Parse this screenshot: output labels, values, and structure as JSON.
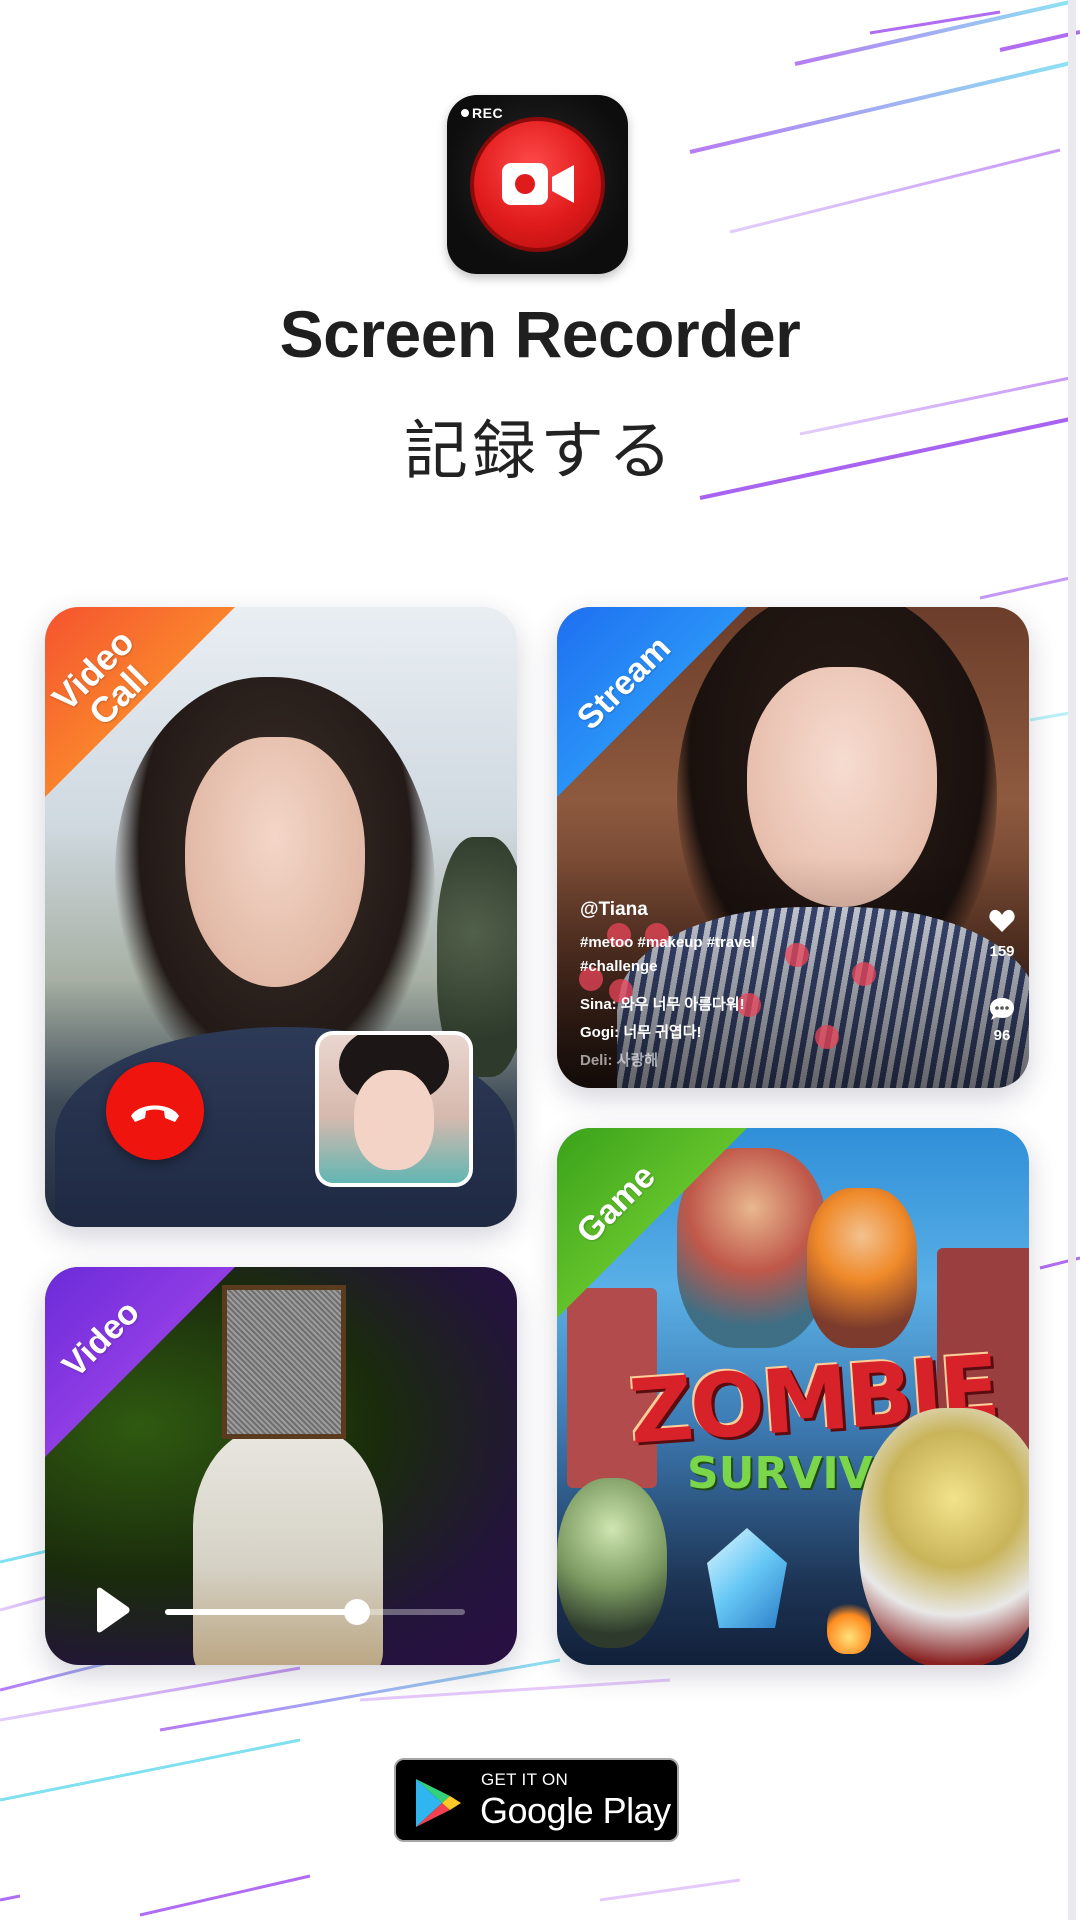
{
  "header": {
    "rec_label": "REC",
    "title": "Screen Recorder",
    "subtitle": "記録する"
  },
  "cards": {
    "video_call": {
      "label_line1": "Video",
      "label_line2": "Call",
      "ribbon_colors": [
        "#f5532f",
        "#ffb12a"
      ]
    },
    "stream": {
      "label": "Stream",
      "ribbon_colors": [
        "#1e6ff0",
        "#35b6ff"
      ],
      "username": "@Tiana",
      "hashtags": "#metoo #makeup #travel #challenge",
      "comments": [
        "Sina: 와우 너무 아름다워!",
        "Gogi: 너무 귀엽다!",
        "Deli: 사랑해"
      ],
      "like_count": "159",
      "comment_count": "96",
      "like_icon": "heart-icon",
      "comment_icon": "speech-bubble-icon"
    },
    "game": {
      "label": "Game",
      "ribbon_colors": [
        "#3aa21a",
        "#8be23b"
      ],
      "logo_line1": "ZOMBIE",
      "logo_line2": "SURVIVAL"
    },
    "video": {
      "label": "Video",
      "ribbon_colors": [
        "#6b2bd9",
        "#b44ef0"
      ],
      "progress": 0.64
    }
  },
  "store_badge": {
    "small_text": "GET IT ON",
    "big_text": "Google Play"
  },
  "colors": {
    "accent_red": "#f0140f",
    "streak_purple": "#b06cf2",
    "streak_cyan": "#7fe0f0"
  }
}
